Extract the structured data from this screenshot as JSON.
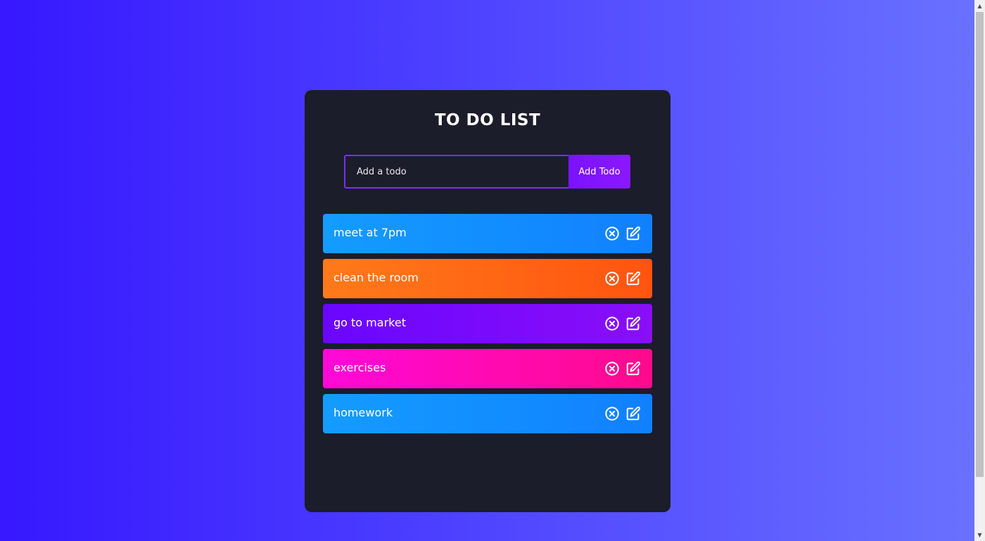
{
  "app": {
    "title": "TO DO LIST"
  },
  "form": {
    "placeholder": "Add a todo",
    "value": "",
    "button_label": "Add Todo"
  },
  "todos": [
    {
      "text": "meet at 7pm",
      "gradient_from": "#149cff",
      "gradient_to": "#1180ff"
    },
    {
      "text": "clean the room",
      "gradient_from": "#ff7a1a",
      "gradient_to": "#ff5410"
    },
    {
      "text": "go to market",
      "gradient_from": "#6a06ff",
      "gradient_to": "#8a0ef8"
    },
    {
      "text": "exercises",
      "gradient_from": "#ff09d8",
      "gradient_to": "#ff0a8c"
    },
    {
      "text": "homework",
      "gradient_from": "#149cff",
      "gradient_to": "#1180ff"
    }
  ],
  "icons": {
    "delete": "close-circle-icon",
    "edit": "edit-icon"
  },
  "colors": {
    "panel": "#1b1d2b",
    "accent": "#7b2cff",
    "background_from": "#3718ff",
    "background_to": "#6a72ff"
  }
}
